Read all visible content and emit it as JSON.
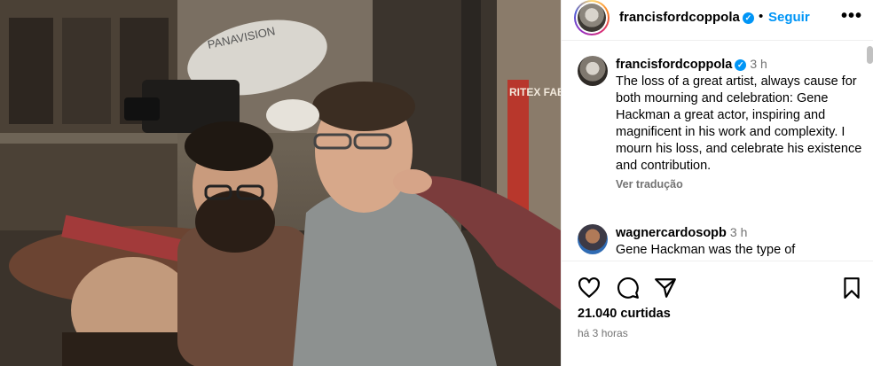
{
  "photo": {
    "camera_brand": "PANAVISION",
    "sign_text": "RITEX FABRICS"
  },
  "header": {
    "username": "francisfordcoppola",
    "verified_icon": "verified-badge-icon",
    "separator": "•",
    "follow_label": "Seguir",
    "more_label": "•••"
  },
  "comments": [
    {
      "username": "francisfordcoppola",
      "time": "3 h",
      "text": "The loss of a great artist, always cause for both mourning and celebration: Gene Hackman a great actor, inspiring and magnificent in his work and complexity. I mourn his loss, and celebrate his existence and contribution.",
      "translate_label": "Ver tradução"
    },
    {
      "username": "wagnercardosopb",
      "time": "3 h",
      "text": "Gene Hackman was the type of"
    }
  ],
  "actions": {
    "like_icon": "heart-icon",
    "comment_icon": "comment-icon",
    "share_icon": "send-icon",
    "save_icon": "bookmark-icon"
  },
  "likes_text": "21.040 curtidas",
  "posted_text": "há 3 horas",
  "colors": {
    "accent": "#0095f6",
    "muted": "#737373",
    "divider": "#efefef"
  }
}
